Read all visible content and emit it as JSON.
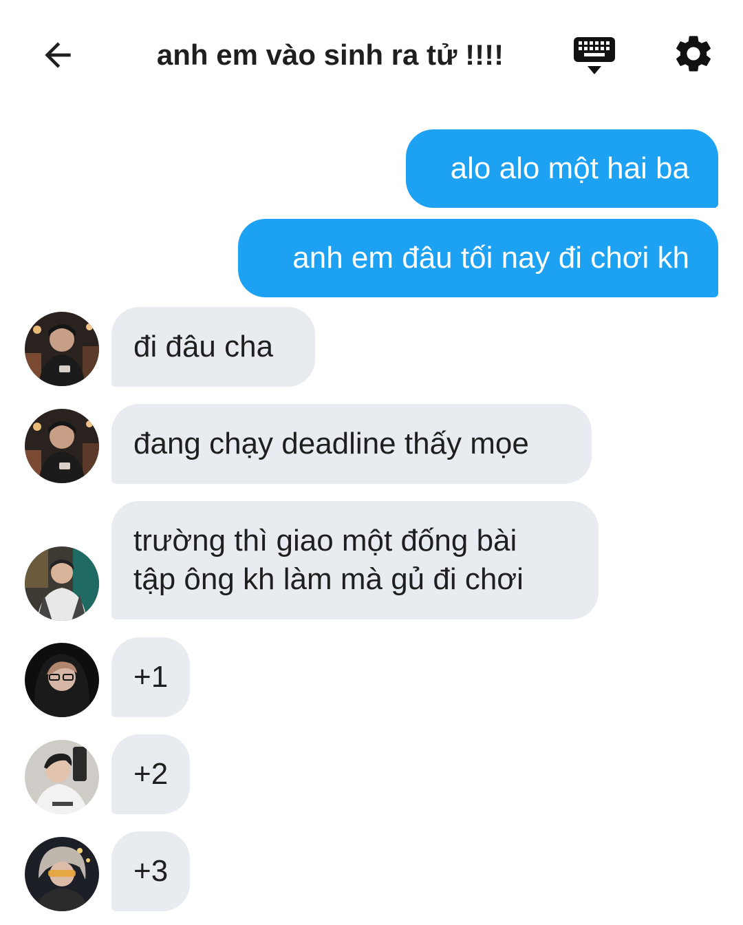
{
  "header": {
    "title": "anh em vào sinh ra tử !!!!",
    "back_icon": "arrow-left-icon",
    "keyboard_icon": "keyboard-hide-icon",
    "settings_icon": "gear-icon"
  },
  "colors": {
    "outgoing_bubble": "#1da1f2",
    "incoming_bubble": "#e8ebef",
    "text": "#1f1f1f"
  },
  "messages": {
    "m1": {
      "direction": "outgoing",
      "text": "alo alo một hai ba"
    },
    "m2": {
      "direction": "outgoing",
      "text": "anh em đâu tối nay đi chơi kh"
    },
    "m3": {
      "direction": "incoming",
      "text": "đi đâu cha",
      "avatar": "avatar-user-1"
    },
    "m4": {
      "direction": "incoming",
      "text": "đang chạy deadline thấy mọe",
      "avatar": "avatar-user-1"
    },
    "m5": {
      "direction": "incoming",
      "line1": "trường thì giao một đống bài",
      "line2": "tập ông kh làm mà gủ đi chơi",
      "avatar": "avatar-user-2"
    },
    "m6": {
      "direction": "incoming",
      "text": "+1",
      "avatar": "avatar-user-3"
    },
    "m7": {
      "direction": "incoming",
      "text": "+2",
      "avatar": "avatar-user-4"
    },
    "m8": {
      "direction": "incoming",
      "text": "+3",
      "avatar": "avatar-user-5"
    }
  }
}
